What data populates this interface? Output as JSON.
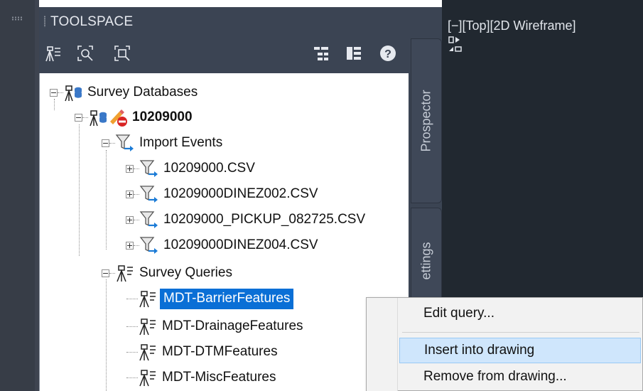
{
  "toolspace": {
    "title": "TOOLSPACE",
    "toolbar_left": [
      "survey-tree-icon",
      "zoom-extents-icon",
      "zoom-selection-icon"
    ],
    "toolbar_right": [
      "tree-view-icon",
      "list-view-icon",
      "help-icon"
    ]
  },
  "tree": {
    "root": "Survey Databases",
    "database": "10209000",
    "import_events": "Import Events",
    "import_items": [
      "10209000.CSV",
      "10209000DINEZ002.CSV",
      "10209000_PICKUP_082725.CSV",
      "10209000DINEZ004.CSV"
    ],
    "survey_queries": "Survey Queries",
    "query_items": [
      "MDT-BarrierFeatures",
      "MDT-DrainageFeatures",
      "MDT-DTMFeatures",
      "MDT-MiscFeatures"
    ],
    "selected": "MDT-BarrierFeatures"
  },
  "side_tabs": [
    "Prospector",
    "ettings"
  ],
  "viewport": {
    "label": "[−][Top][2D Wireframe]"
  },
  "context_menu": {
    "items": [
      "Edit query...",
      "Insert into drawing",
      "Remove from drawing..."
    ],
    "highlighted": "Insert into drawing"
  },
  "colors": {
    "panel": "#3b4453",
    "viewport": "#212830",
    "selection": "#0a6fd6",
    "menu_highlight": "#cfe6fc"
  }
}
